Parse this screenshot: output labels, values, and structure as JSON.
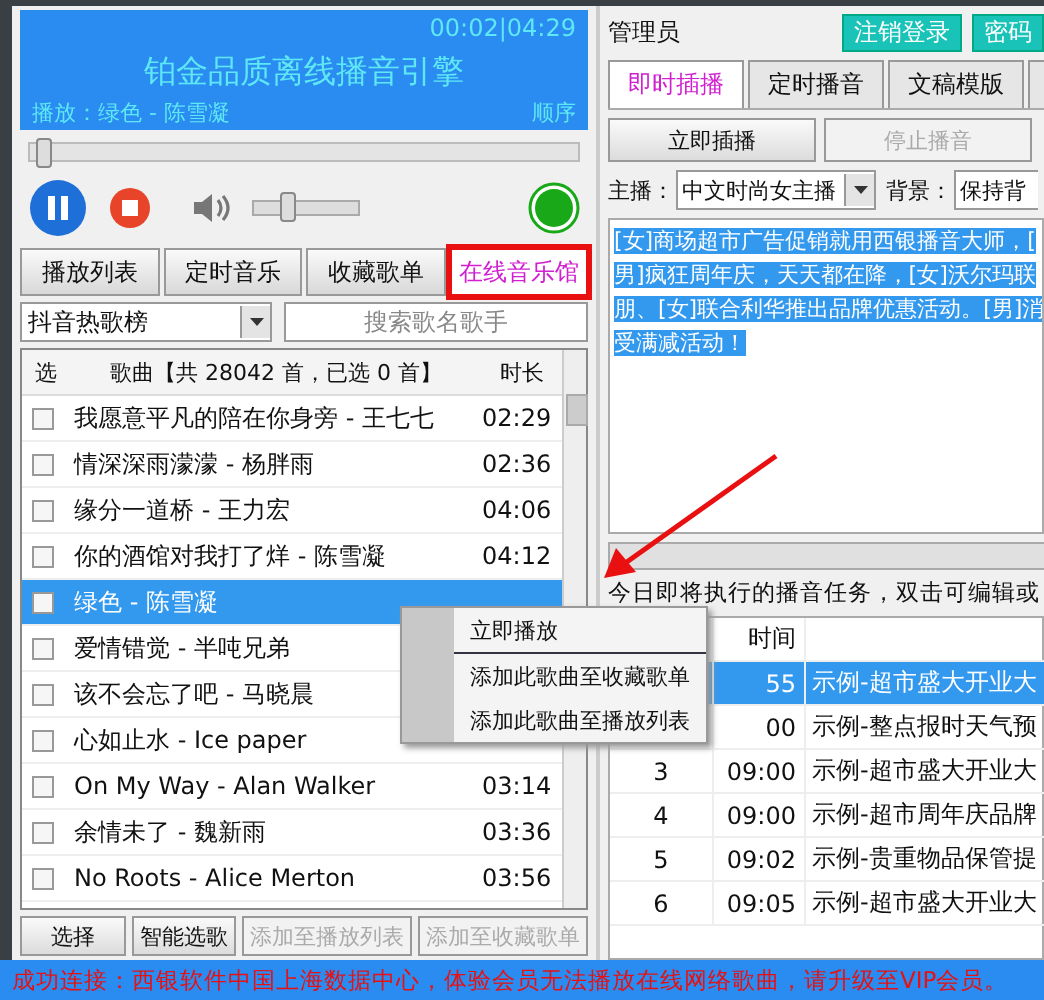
{
  "player": {
    "time": "00:02|04:29",
    "title": "铂金品质离线播音引擎",
    "now_playing": "播放：绿色 - 陈雪凝",
    "mode": "顺序",
    "playing": true,
    "connected": true,
    "progress": {
      "level": 0.01
    },
    "volume": {
      "level": 0.3
    }
  },
  "left_tabs": [
    {
      "label": "播放列表",
      "selected": false,
      "highlighted": false
    },
    {
      "label": "定时音乐",
      "selected": false,
      "highlighted": false
    },
    {
      "label": "收藏歌单",
      "selected": false,
      "highlighted": false
    },
    {
      "label": "在线音乐馆",
      "selected": true,
      "highlighted": true
    }
  ],
  "chart_filter": {
    "value": "抖音热歌榜"
  },
  "search": {
    "placeholder": "搜索歌名歌手"
  },
  "songs": {
    "columns": [
      "选",
      "歌曲【共 28042 首，已选 0 首】",
      "时长"
    ],
    "rows": [
      {
        "title": "我愿意平凡的陪在你身旁 - 王七七",
        "duration": "02:29",
        "checked": false,
        "selected": false
      },
      {
        "title": "情深深雨濛濛 - 杨胖雨",
        "duration": "02:36",
        "checked": false,
        "selected": false
      },
      {
        "title": "缘分一道桥 - 王力宏",
        "duration": "04:06",
        "checked": false,
        "selected": false
      },
      {
        "title": "你的酒馆对我打了烊 - 陈雪凝",
        "duration": "04:12",
        "checked": false,
        "selected": false
      },
      {
        "title": "绿色 - 陈雪凝",
        "checked": false,
        "selected": true
      },
      {
        "title": "爱情错觉 - 半吨兄弟",
        "checked": false,
        "selected": false
      },
      {
        "title": "该不会忘了吧 - 马晓晨",
        "checked": false,
        "selected": false
      },
      {
        "title": "心如止水 - Ice paper",
        "checked": false,
        "selected": false
      },
      {
        "title": "On My Way - Alan Walker",
        "duration": "03:14",
        "checked": false,
        "selected": false
      },
      {
        "title": "余情未了 - 魏新雨",
        "duration": "03:36",
        "checked": false,
        "selected": false
      },
      {
        "title": "No Roots - Alice Merton",
        "duration": "03:56",
        "checked": false,
        "selected": false
      }
    ]
  },
  "song_buttons": [
    {
      "label": "选择",
      "disabled": false
    },
    {
      "label": "智能选歌",
      "disabled": false
    },
    {
      "label": "添加至播放列表",
      "disabled": true
    },
    {
      "label": "添加至收藏歌单",
      "disabled": true
    }
  ],
  "context_menu": {
    "items": [
      {
        "label": "立即播放",
        "separator_after": true
      },
      {
        "label": "添加此歌曲至收藏歌单",
        "separator_after": false
      },
      {
        "label": "添加此歌曲至播放列表",
        "separator_after": false
      }
    ]
  },
  "admin": {
    "user": "管理员",
    "buttons": [
      "注销登录",
      "密码"
    ],
    "tabs": [
      {
        "label": "即时插播",
        "selected": true
      },
      {
        "label": "定时播音",
        "selected": false
      },
      {
        "label": "文稿模版",
        "selected": false
      }
    ],
    "actions": [
      {
        "label": "立即插播",
        "disabled": false
      },
      {
        "label": "停止播音",
        "disabled": true
      }
    ],
    "anchor": {
      "label": "主播：",
      "value": "中文时尚女主播"
    },
    "background": {
      "label": "背景：",
      "value": "保持背"
    },
    "script_lines": [
      "[女]商场超市广告促销就用西银播音大师，[",
      "男]疯狂周年庆，天天都在降，[女]沃尔玛联",
      "朋、[女]联合利华推出品牌优惠活动。[男]消",
      "受满减活动！"
    ],
    "tasks_caption": "今日即将执行的播音任务，双击可编辑或",
    "tasks": {
      "columns": [
        "时间"
      ],
      "rows": [
        {
          "time": "55",
          "name": "示例-超市盛大开业大",
          "selected": true
        },
        {
          "time": "00",
          "name": "示例-整点报时天气预",
          "selected": false
        },
        {
          "no": "3",
          "time": "09:00",
          "name": "示例-超市盛大开业大",
          "selected": false
        },
        {
          "no": "4",
          "time": "09:00",
          "name": "示例-超市周年庆品牌",
          "selected": false
        },
        {
          "no": "5",
          "time": "09:02",
          "name": "示例-贵重物品保管提",
          "selected": false
        },
        {
          "no": "6",
          "time": "09:05",
          "name": "示例-超市盛大开业大",
          "selected": false
        }
      ]
    }
  },
  "status_bar": "成功连接：西银软件中国上海数据中心，体验会员无法播放在线网络歌曲，请升级至VIP会员。"
}
